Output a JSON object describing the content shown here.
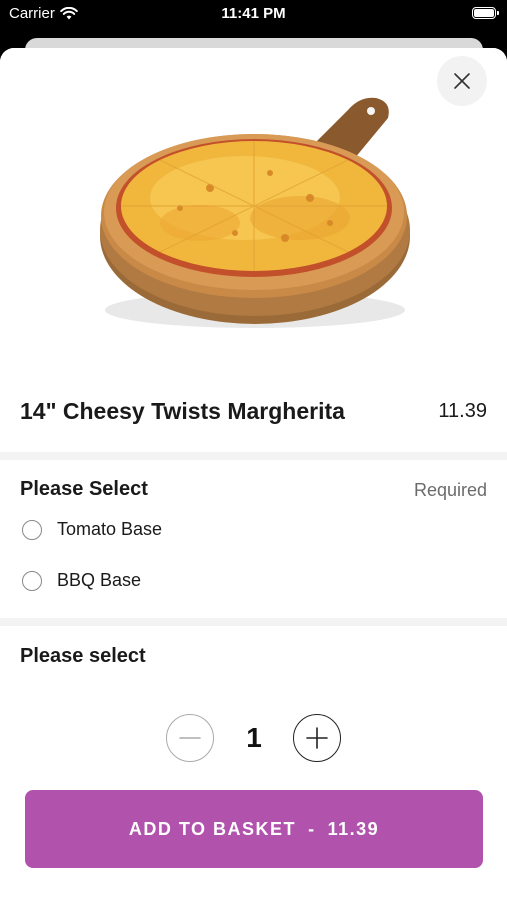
{
  "status_bar": {
    "carrier": "Carrier",
    "time": "11:41 PM"
  },
  "product": {
    "name": "14\" Cheesy Twists Margherita",
    "price": "11.39"
  },
  "section1": {
    "title": "Please Select",
    "required_label": "Required",
    "options": [
      {
        "label": "Tomato Base"
      },
      {
        "label": "BBQ Base"
      }
    ]
  },
  "section2": {
    "title": "Please select"
  },
  "quantity": {
    "value": "1"
  },
  "add_button": {
    "label": "ADD TO BASKET",
    "separator": "-",
    "price": "11.39"
  },
  "colors": {
    "accent": "#b152ad"
  },
  "icons": [
    "wifi-icon",
    "battery-icon",
    "close-icon",
    "minus-icon",
    "plus-icon"
  ]
}
